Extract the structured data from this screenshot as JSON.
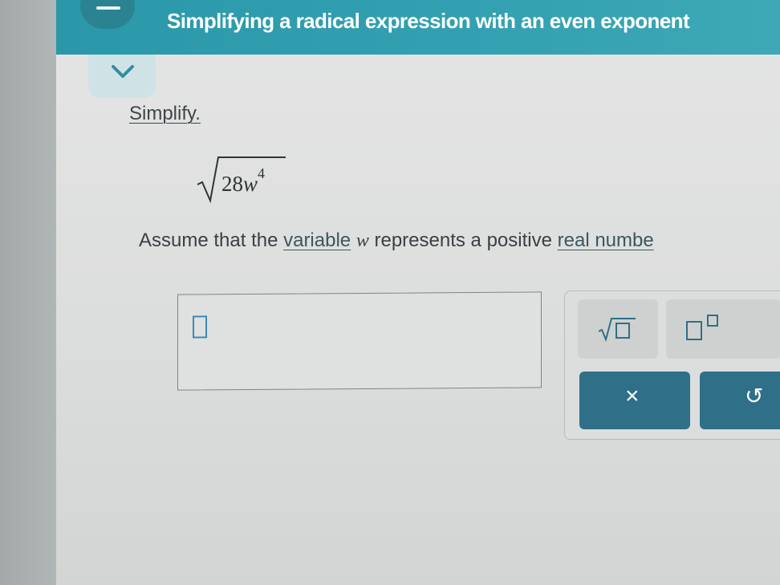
{
  "header": {
    "title": "Simplifying a radical expression with an even exponent"
  },
  "problem": {
    "instruction": "Simplify.",
    "radicand_coefficient": "28",
    "radicand_variable": "w",
    "radicand_exponent": "4",
    "assume_prefix": "Assume that the ",
    "assume_link_variable": "variable",
    "assume_space_before_var": " ",
    "assume_var": "w",
    "assume_middle": " represents a positive ",
    "assume_link_real": "real numbe"
  },
  "answer": {
    "value": ""
  },
  "toolpad": {
    "clear_symbol": "×",
    "undo_symbol": "↺"
  },
  "colors": {
    "header": "#33a1b1",
    "key_dark": "#2f6f88",
    "cursor": "#3c8ab8"
  },
  "icons": [
    "menu-icon",
    "chevron-down-icon",
    "square-root-icon",
    "superscript-icon",
    "clear-icon",
    "undo-icon"
  ]
}
